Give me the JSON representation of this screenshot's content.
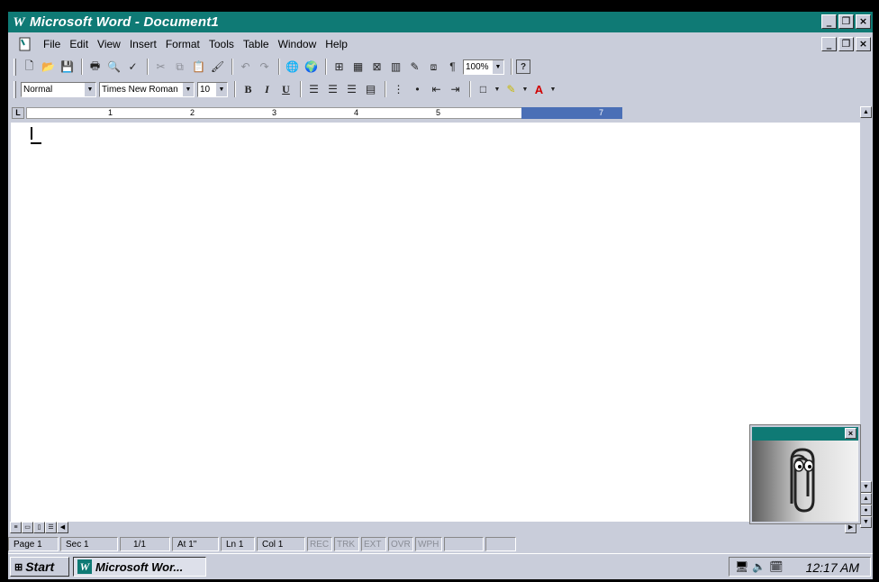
{
  "window": {
    "title": "Microsoft Word - Document1",
    "app_icon_letter": "W",
    "minimize": "_",
    "restore": "×",
    "close": "×"
  },
  "menus": [
    {
      "label": "File"
    },
    {
      "label": "Edit"
    },
    {
      "label": "View"
    },
    {
      "label": "Insert"
    },
    {
      "label": "Format"
    },
    {
      "label": "Tools"
    },
    {
      "label": "Table"
    },
    {
      "label": "Window"
    },
    {
      "label": "Help"
    }
  ],
  "toolbar": {
    "zoom": "100%",
    "style": "Normal",
    "font": "Times New Roman",
    "size": "10",
    "bold": "B",
    "italic": "I",
    "underline": "U",
    "pilcrow": "¶",
    "help": "?"
  },
  "ruler": {
    "tab_marker": "L",
    "numbers": [
      "1",
      "2",
      "3",
      "4",
      "5",
      "7"
    ]
  },
  "status": {
    "page": "Page 1",
    "sec": "Sec 1",
    "pages": "1/1",
    "at": "At 1\"",
    "ln": "Ln 1",
    "col": "Col 1",
    "rec": "REC",
    "trk": "TRK",
    "ext": "EXT",
    "ovr": "OVR",
    "wph": "WPH"
  },
  "taskbar": {
    "start": "Start",
    "task": "Microsoft Wor...",
    "clock": "12:17 AM"
  },
  "colors": {
    "title_bar": "#0f7a75",
    "chrome": "#c9cdda",
    "ruler_margin": "#4a6fb6"
  }
}
